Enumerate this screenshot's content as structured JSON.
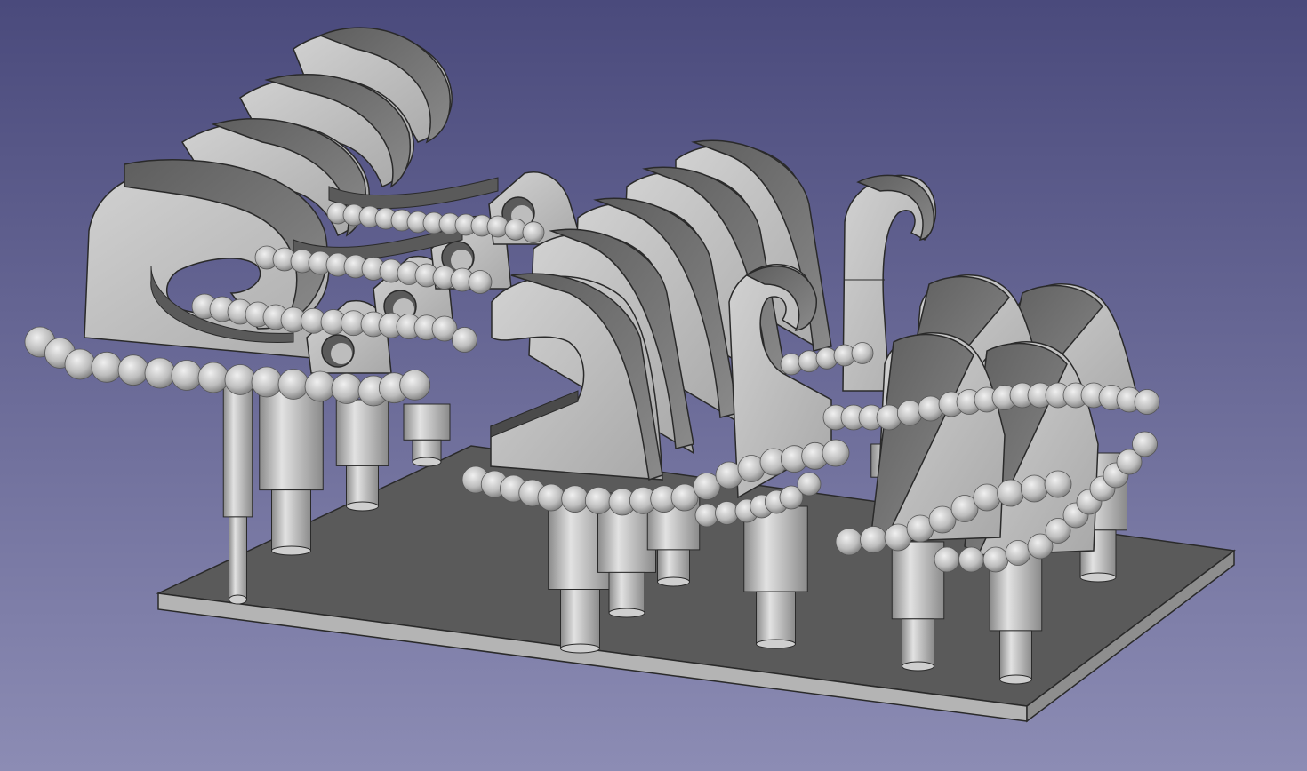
{
  "viewport": {
    "background_top": "#4a4a7c",
    "background_bottom": "#8c8cb4"
  },
  "model": {
    "base_plate_top": "#5a5a5a",
    "base_plate_edge": "#b4b4b4",
    "part_face": "#b8b8b8",
    "part_side": "#6a6a6a",
    "part_highlight": "#dcdcdc",
    "outline": "#2a2a2a"
  }
}
